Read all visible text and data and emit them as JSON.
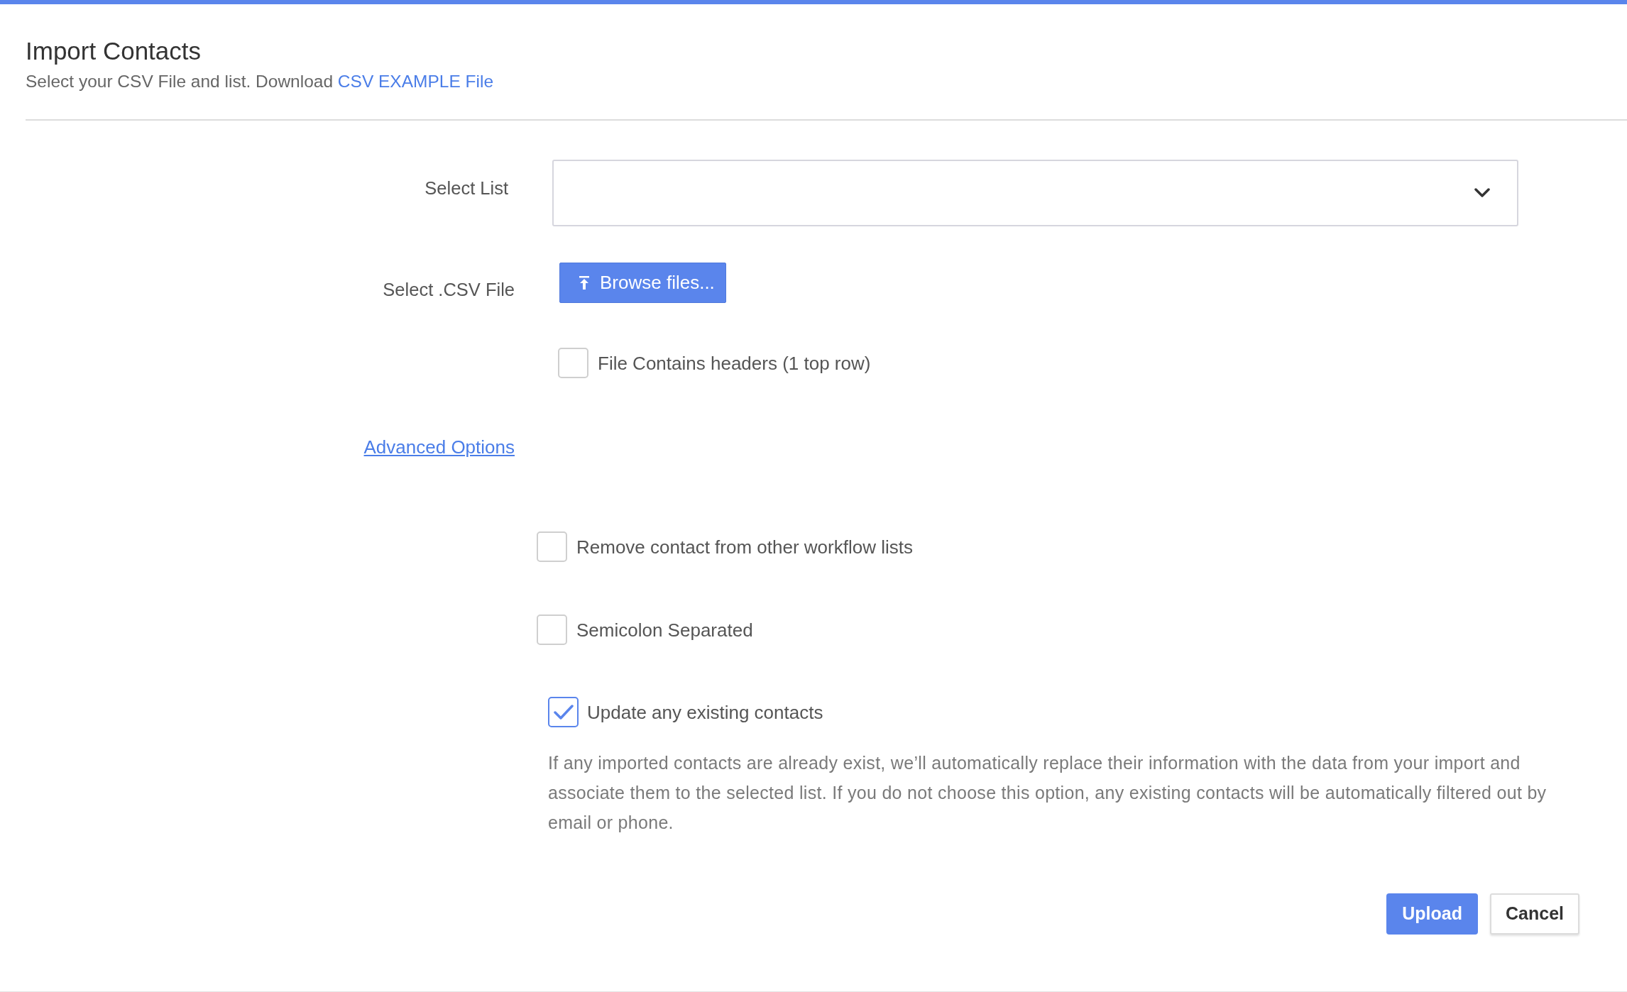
{
  "header": {
    "title": "Import Contacts",
    "subtitle": "Select your CSV File and list. Download",
    "subtitle_link": "CSV EXAMPLE File"
  },
  "form": {
    "select_list": {
      "label": "Select List"
    },
    "csv_file": {
      "label": "Select .CSV File",
      "button": "Browse files..."
    },
    "headers": {
      "label": "File Contains headers (1 top row)",
      "checked": false
    },
    "advanced_options_link": "Advanced Options",
    "advanced_options": [
      {
        "label": "Remove contact from other workflow lists",
        "checked": false
      },
      {
        "label": "Semicolon Separated",
        "checked": false
      }
    ],
    "update_existing": {
      "label": "Update any existing contacts",
      "checked": true,
      "note": "If any imported contacts are already exist, we’ll automatically replace their information with the data from your import and associate them to the selected list. If you do not choose this option, any existing contacts will be automatically filtered out by email or phone."
    }
  },
  "buttons": [
    {
      "label": "Upload",
      "kind": "primary"
    },
    {
      "label": "Cancel",
      "kind": "secondary"
    }
  ]
}
